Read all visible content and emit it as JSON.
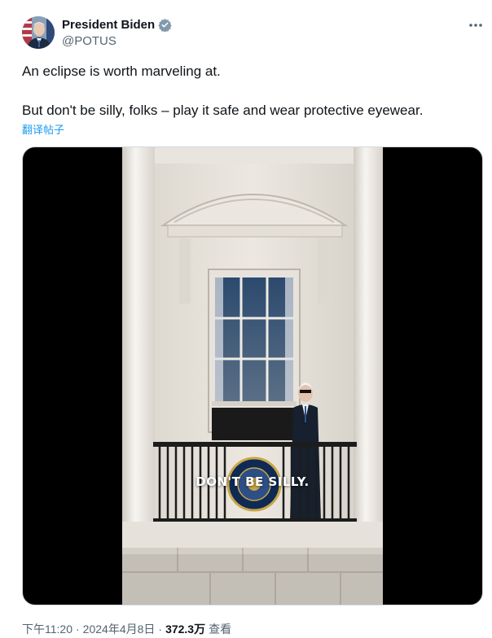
{
  "author": {
    "display_name": "President Biden",
    "handle": "@POTUS",
    "verified": true
  },
  "icons": {
    "verified": "verified-badge-icon",
    "more": "more-options-icon"
  },
  "colors": {
    "text_primary": "#0f1419",
    "text_secondary": "#536471",
    "link": "#1d9bf0"
  },
  "tweet": {
    "line1": "An eclipse is worth marveling at.",
    "line2": "But don't be silly, folks – play it safe and wear protective eyewear.",
    "translate_label": "翻译帖子"
  },
  "media": {
    "caption": "DON'T BE SILLY."
  },
  "meta": {
    "time": "下午11:20",
    "date": "2024年4月8日",
    "views_count": "372.3万",
    "views_label": "查看"
  }
}
